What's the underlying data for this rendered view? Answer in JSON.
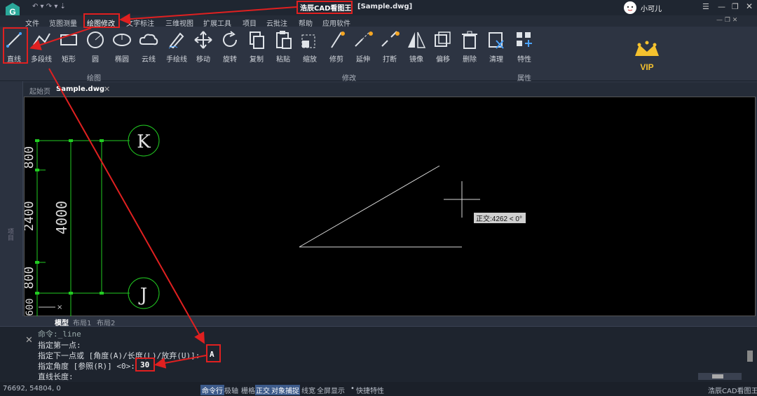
{
  "window": {
    "app_title": "浩辰CAD看图王",
    "doc_title": "[Sample.dwg]",
    "user_name": "小可儿"
  },
  "menu": [
    "文件",
    "览图测量",
    "绘图修改",
    "文字标注",
    "三维视图",
    "扩展工具",
    "项目",
    "云批注",
    "帮助",
    "应用软件"
  ],
  "ribbon": {
    "draw_tools": [
      "直线",
      "多段线",
      "矩形",
      "圆",
      "椭圆",
      "云线",
      "手绘线"
    ],
    "modify_tools": [
      "移动",
      "旋转",
      "复制",
      "粘贴",
      "缩放",
      "修剪",
      "延伸",
      "打断",
      "镜像",
      "偏移",
      "删除",
      "清理"
    ],
    "prop_tools": [
      "特性"
    ],
    "group_draw": "绘图",
    "group_modify": "修改",
    "group_prop": "属性",
    "vip": "VIP"
  },
  "tabs": {
    "start": "起始页",
    "file": "Sample.dwg"
  },
  "left_panel": "项目",
  "drawing": {
    "dims": [
      "800",
      "2400",
      "800",
      "600"
    ],
    "dim_total": "4000",
    "axis_k": "K",
    "axis_j": "J",
    "tooltip": "正交:4262 < 0°"
  },
  "layout_tabs": [
    "模型",
    "布局1",
    "布局2"
  ],
  "command": {
    "lines": [
      "命令:_line",
      "指定第一点:",
      "指定下一点或 [角度(A)/长度(L)/放弃(U)]:",
      "指定角度 [参照(R)] <0>:",
      "直线长度:"
    ],
    "input_a": "A",
    "input_angle": "30"
  },
  "status": {
    "coords": "76692, 54804, 0",
    "items": [
      "命令行",
      "极轴",
      "栅格",
      "正交",
      "对象捕捉",
      "线宽",
      "全屏显示",
      "快捷特性"
    ],
    "brand": "浩辰CAD看图王"
  }
}
